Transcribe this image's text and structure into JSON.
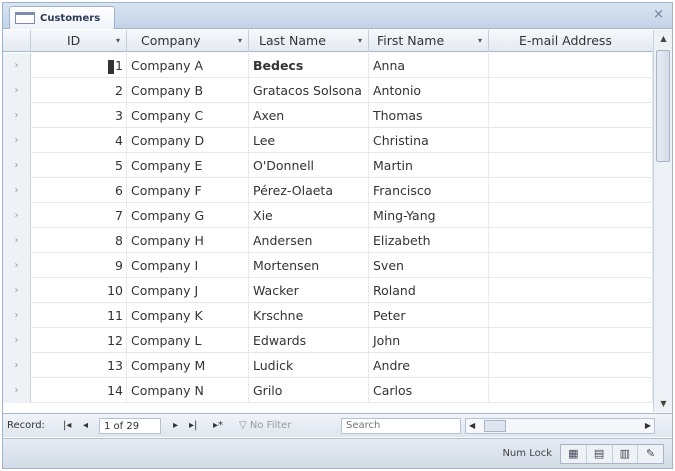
{
  "tab": {
    "title": "Customers",
    "close": "×"
  },
  "columns": [
    {
      "label": "ID"
    },
    {
      "label": "Company"
    },
    {
      "label": "Last Name"
    },
    {
      "label": "First Name"
    },
    {
      "label": "E-mail Address"
    }
  ],
  "rows": [
    {
      "id": "1",
      "company": "Company A",
      "last": "Bedecs",
      "first": "Anna"
    },
    {
      "id": "2",
      "company": "Company B",
      "last": "Gratacos Solsona",
      "first": "Antonio"
    },
    {
      "id": "3",
      "company": "Company C",
      "last": "Axen",
      "first": "Thomas"
    },
    {
      "id": "4",
      "company": "Company D",
      "last": "Lee",
      "first": "Christina"
    },
    {
      "id": "5",
      "company": "Company E",
      "last": "O'Donnell",
      "first": "Martin"
    },
    {
      "id": "6",
      "company": "Company F",
      "last": "Pérez-Olaeta",
      "first": "Francisco"
    },
    {
      "id": "7",
      "company": "Company G",
      "last": "Xie",
      "first": "Ming-Yang"
    },
    {
      "id": "8",
      "company": "Company H",
      "last": "Andersen",
      "first": "Elizabeth"
    },
    {
      "id": "9",
      "company": "Company I",
      "last": "Mortensen",
      "first": "Sven"
    },
    {
      "id": "10",
      "company": "Company J",
      "last": "Wacker",
      "first": "Roland"
    },
    {
      "id": "11",
      "company": "Company K",
      "last": "Krschne",
      "first": "Peter"
    },
    {
      "id": "12",
      "company": "Company L",
      "last": "Edwards",
      "first": "John"
    },
    {
      "id": "13",
      "company": "Company M",
      "last": "Ludick",
      "first": "Andre"
    },
    {
      "id": "14",
      "company": "Company N",
      "last": "Grilo",
      "first": "Carlos"
    }
  ],
  "nav": {
    "record_label": "Record:",
    "first": "|◂",
    "prev": "◂",
    "position": "1 of 29",
    "next": "▸",
    "last": "▸|",
    "new": "▸*",
    "filter": "No Filter",
    "search_placeholder": "Search"
  },
  "status": {
    "numlock": "Num Lock"
  },
  "colors": {
    "accent": "#9fb3cd",
    "header_bg": "#e4eaf2"
  }
}
